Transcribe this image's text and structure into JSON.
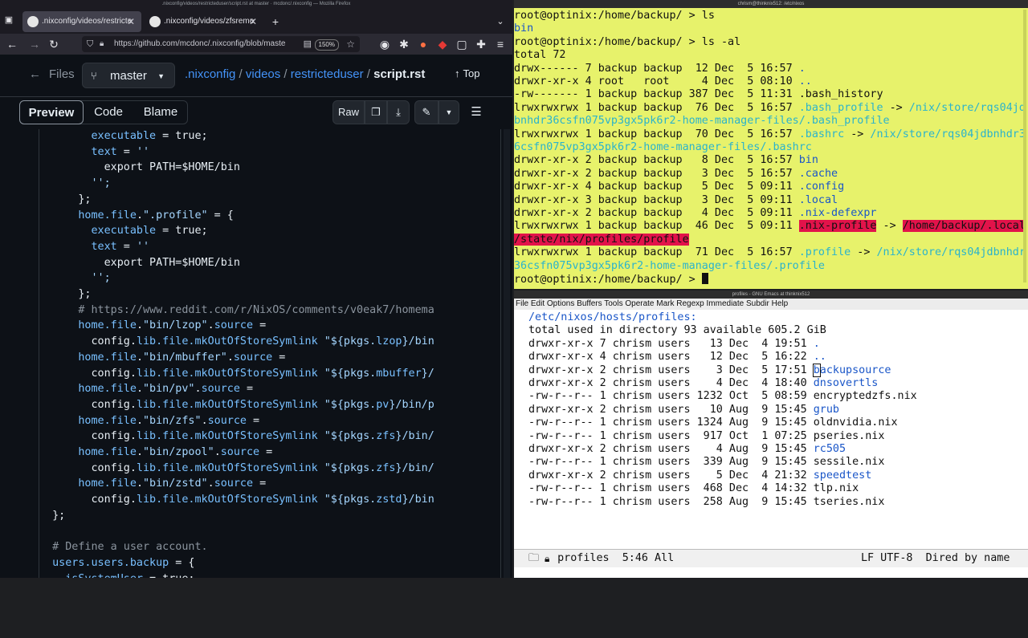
{
  "firefox": {
    "title": ".nixconfig/videos/restricteduser/script.rst at master · mcdonc/.nixconfig — Mozilla Firefox",
    "tabs": [
      {
        "label": ".nixconfig/videos/restricte"
      },
      {
        "label": ".nixconfig/videos/zfsremo"
      }
    ],
    "url": "https://github.com/mcdonc/.nixconfig/blob/maste",
    "zoom": "150%"
  },
  "github": {
    "files_label": "Files",
    "branch": "master",
    "breadcrumb": {
      "repo": ".nixconfig",
      "sep": " / ",
      "dir1": "videos",
      "dir2": "restricteduser",
      "file": "script.rst"
    },
    "top_label": "Top",
    "tabs": {
      "preview": "Preview",
      "code": "Code",
      "blame": "Blame"
    },
    "raw_label": "Raw"
  },
  "terminal": {
    "title": "chrism@thinknix512: /etc/nixos",
    "prompt": "root@optinix:/home/backup/ > "
  },
  "emacs": {
    "title": "profiles - GNU Emacs at thinknix512",
    "menu": "File Edit Options Buffers Tools Operate Mark Regexp Immediate Subdir Help",
    "modeline": "  profiles  5:46 All",
    "modeline_right": "LF UTF-8  Dired by name"
  }
}
